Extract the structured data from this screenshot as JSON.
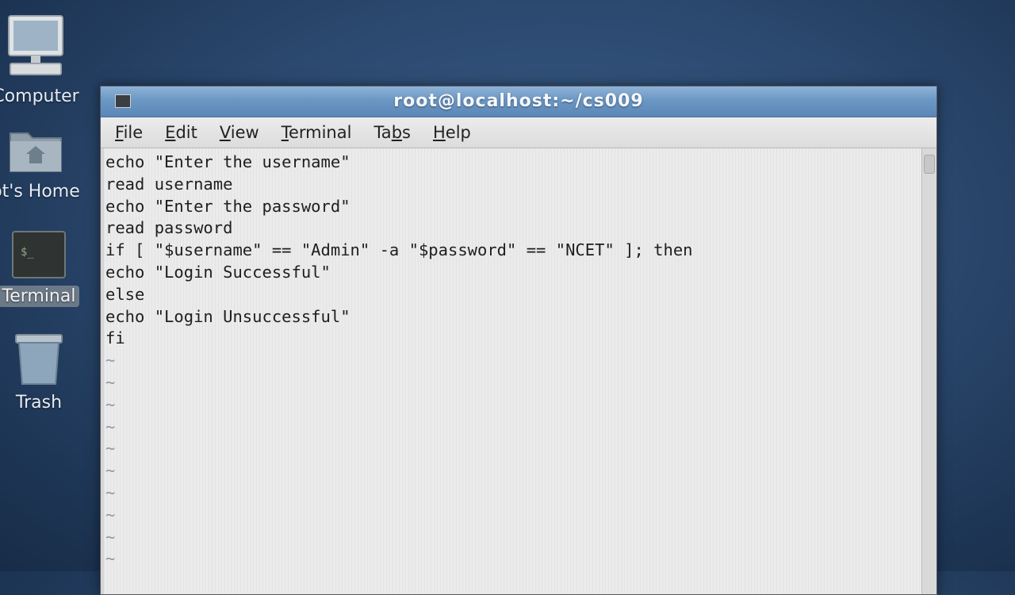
{
  "desktop": {
    "icons": [
      {
        "label": "Computer"
      },
      {
        "label": "ot's Home"
      },
      {
        "label": "Terminal"
      },
      {
        "label": "Trash"
      }
    ]
  },
  "window": {
    "title": "root@localhost:~/cs009",
    "menu": [
      {
        "label": "File",
        "accel": "F",
        "rest": "ile"
      },
      {
        "label": "Edit",
        "accel": "E",
        "rest": "dit"
      },
      {
        "label": "View",
        "accel": "V",
        "rest": "iew"
      },
      {
        "label": "Terminal",
        "accel": "T",
        "rest": "erminal"
      },
      {
        "label": "Tabs",
        "pre": "Ta",
        "accel": "b",
        "rest": "s"
      },
      {
        "label": "Help",
        "accel": "H",
        "rest": "elp"
      }
    ]
  },
  "terminal": {
    "lines": [
      "echo \"Enter the username\"",
      "read username",
      "echo \"Enter the password\"",
      "read password",
      "if [ \"$username\" == \"Admin\" -a \"$password\" == \"NCET\" ]; then",
      "echo \"Login Successful\"",
      "else",
      "echo \"Login Unsuccessful\"",
      "fi"
    ],
    "empty_marker": "~",
    "empty_lines": 10
  },
  "colors": {
    "titlebar": "#6b97c4",
    "terminal_bg": "#ebebeb",
    "desktop_bg": "#2c4a70"
  }
}
